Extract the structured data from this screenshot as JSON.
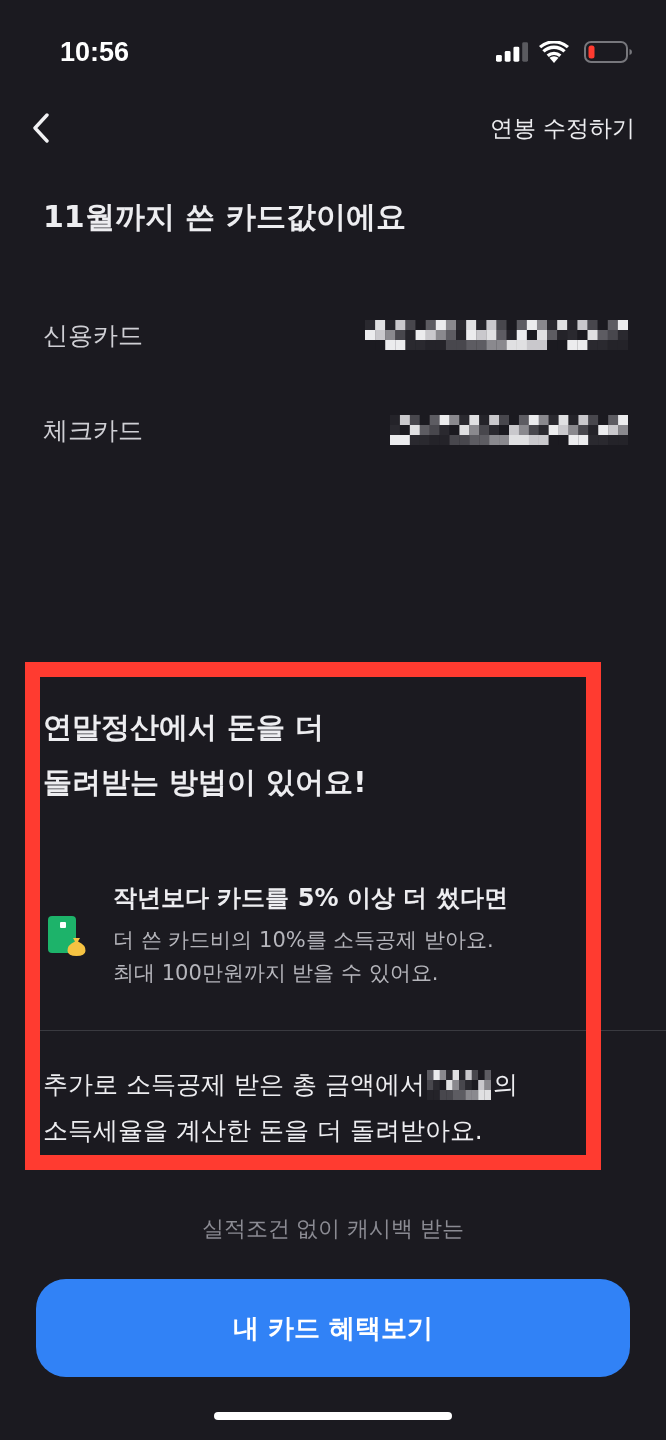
{
  "status_bar": {
    "time": "10:56"
  },
  "nav": {
    "action": "연봉 수정하기"
  },
  "title": "11월까지 쓴 카드값이에요",
  "card_totals": [
    {
      "label": "신용카드"
    },
    {
      "label": "체크카드"
    }
  ],
  "tip_section": {
    "heading_lines": [
      "연말정산에서 돈을 더",
      "돌려받는 방법이 있어요!"
    ],
    "item": {
      "title": "작년보다 카드를 5% 이상 더 썼다면",
      "description_lines": [
        "더 쓴 카드비의 10%를 소득공제 받아요.",
        "최대 100만원까지 받을 수 있어요."
      ]
    },
    "note": {
      "before": "추가로 소득공제 받은 총 금액에서",
      "after": "의",
      "line_2": "소득세율을 계산한 돈을 더 돌려받아요."
    }
  },
  "caption": "실적조건 없이 캐시백 받는",
  "button": {
    "label": "내 카드 혜택보기"
  }
}
